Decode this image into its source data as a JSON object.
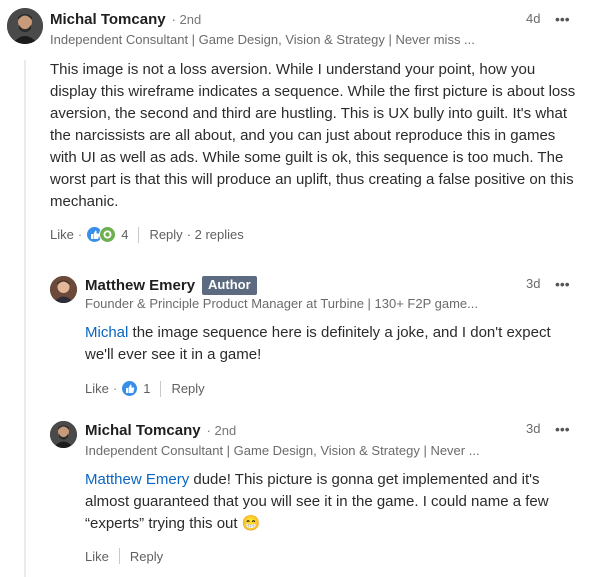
{
  "comments": [
    {
      "name": "Michal Tomcany",
      "degree": "· 2nd",
      "headline": "Independent Consultant | Game Design, Vision & Strategy | Never miss ...",
      "time": "4d",
      "body": "This image is not a loss aversion. While I understand your point, how you display this wireframe indicates a sequence. While the first picture is about loss aversion, the second and third are hustling. This is UX bully into guilt. It's what the narcissists are all about, and you can just about reproduce this in games with UI as well as ads. While some guilt is ok, this sequence is too much. The worst part is that this will produce an uplift, thus creating a false positive on this mechanic.",
      "like_label": "Like",
      "reaction_count": "4",
      "reply_label": "Reply",
      "replies_label": "· 2 replies",
      "reaction_icons": [
        "like-icon",
        "support-icon"
      ]
    },
    {
      "name": "Matthew Emery",
      "badge": "Author",
      "headline": "Founder & Principle Product Manager at Turbine | 130+ F2P game...",
      "time": "3d",
      "mention": "Michal",
      "body": " the image sequence here is definitely a joke, and I don't expect we'll ever see it in a game!",
      "like_label": "Like",
      "reaction_count": "1",
      "reply_label": "Reply",
      "reaction_icons": [
        "like-icon"
      ]
    },
    {
      "name": "Michal Tomcany",
      "degree": "· 2nd",
      "headline": "Independent Consultant | Game Design, Vision & Strategy | Never ...",
      "time": "3d",
      "mention": "Matthew Emery",
      "body": " dude! This picture is gonna get implemented and it's almost guaranteed that you will see it in the game. I could name a few “experts” trying this out",
      "emoji": "😁",
      "like_label": "Like",
      "reply_label": "Reply"
    }
  ],
  "more_icon": "more-horizontal-icon",
  "more_glyph": "•••",
  "colors": {
    "mention": "#0a66c2",
    "badge": "#5c6b7f",
    "like_blue": "#378fe9",
    "support_green": "#6dae4f"
  }
}
